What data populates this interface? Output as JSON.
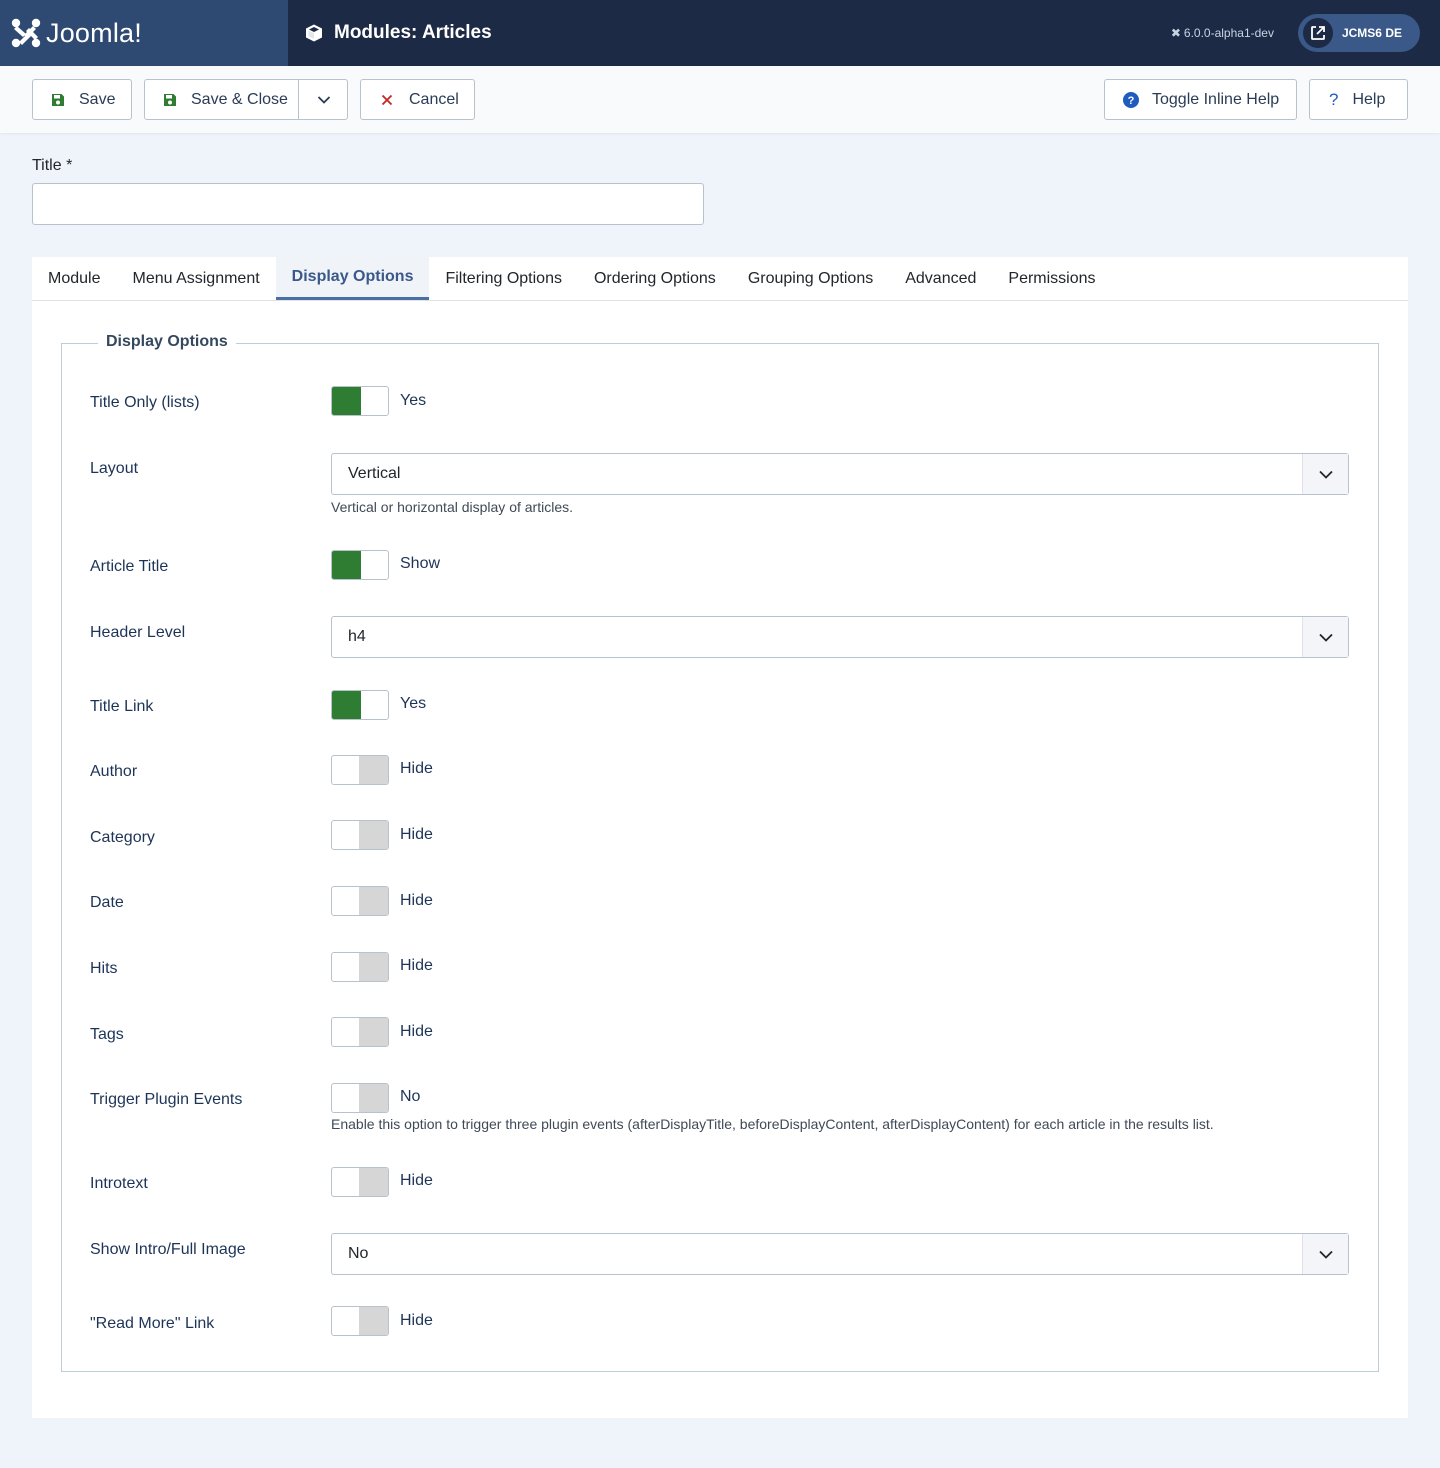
{
  "header": {
    "brand_name": "Joomla!",
    "page_title": "Modules: Articles",
    "version": "6.0.0-alpha1-dev",
    "site_button": "JCMS6 DE"
  },
  "toolbar": {
    "save": "Save",
    "save_close": "Save & Close",
    "cancel": "Cancel",
    "toggle_inline_help": "Toggle Inline Help",
    "help": "Help"
  },
  "title_field": {
    "label": "Title *",
    "value": ""
  },
  "tabs": [
    {
      "label": "Module"
    },
    {
      "label": "Menu Assignment"
    },
    {
      "label": "Display Options",
      "active": true
    },
    {
      "label": "Filtering Options"
    },
    {
      "label": "Ordering Options"
    },
    {
      "label": "Grouping Options"
    },
    {
      "label": "Advanced"
    },
    {
      "label": "Permissions"
    }
  ],
  "display_options": {
    "legend": "Display Options",
    "title_only": {
      "label": "Title Only (lists)",
      "value": "Yes",
      "on": true
    },
    "layout": {
      "label": "Layout",
      "value": "Vertical",
      "help": "Vertical or horizontal display of articles."
    },
    "article_title": {
      "label": "Article Title",
      "value": "Show",
      "on": true
    },
    "header_level": {
      "label": "Header Level",
      "value": "h4"
    },
    "title_link": {
      "label": "Title Link",
      "value": "Yes",
      "on": true
    },
    "author": {
      "label": "Author",
      "value": "Hide",
      "on": false
    },
    "category": {
      "label": "Category",
      "value": "Hide",
      "on": false
    },
    "date": {
      "label": "Date",
      "value": "Hide",
      "on": false
    },
    "hits": {
      "label": "Hits",
      "value": "Hide",
      "on": false
    },
    "tags": {
      "label": "Tags",
      "value": "Hide",
      "on": false
    },
    "trigger_plugin_events": {
      "label": "Trigger Plugin Events",
      "value": "No",
      "on": false,
      "help": "Enable this option to trigger three plugin events (afterDisplayTitle, beforeDisplayContent, afterDisplayContent) for each article in the results list."
    },
    "introtext": {
      "label": "Introtext",
      "value": "Hide",
      "on": false
    },
    "intro_full_image": {
      "label": "Show Intro/Full Image",
      "value": "No"
    },
    "read_more": {
      "label": "\"Read More\" Link",
      "value": "Hide",
      "on": false
    }
  },
  "colors": {
    "header_bg": "#1c2a45",
    "brand_bg": "#2f4a72",
    "toggle_on": "#2e7d32",
    "toggle_off": "#d6d6d6",
    "tab_active": "#3a5988",
    "cancel_icon": "#c52828",
    "save_icon": "#2e7d32",
    "help_icon": "#1f5bbf"
  }
}
